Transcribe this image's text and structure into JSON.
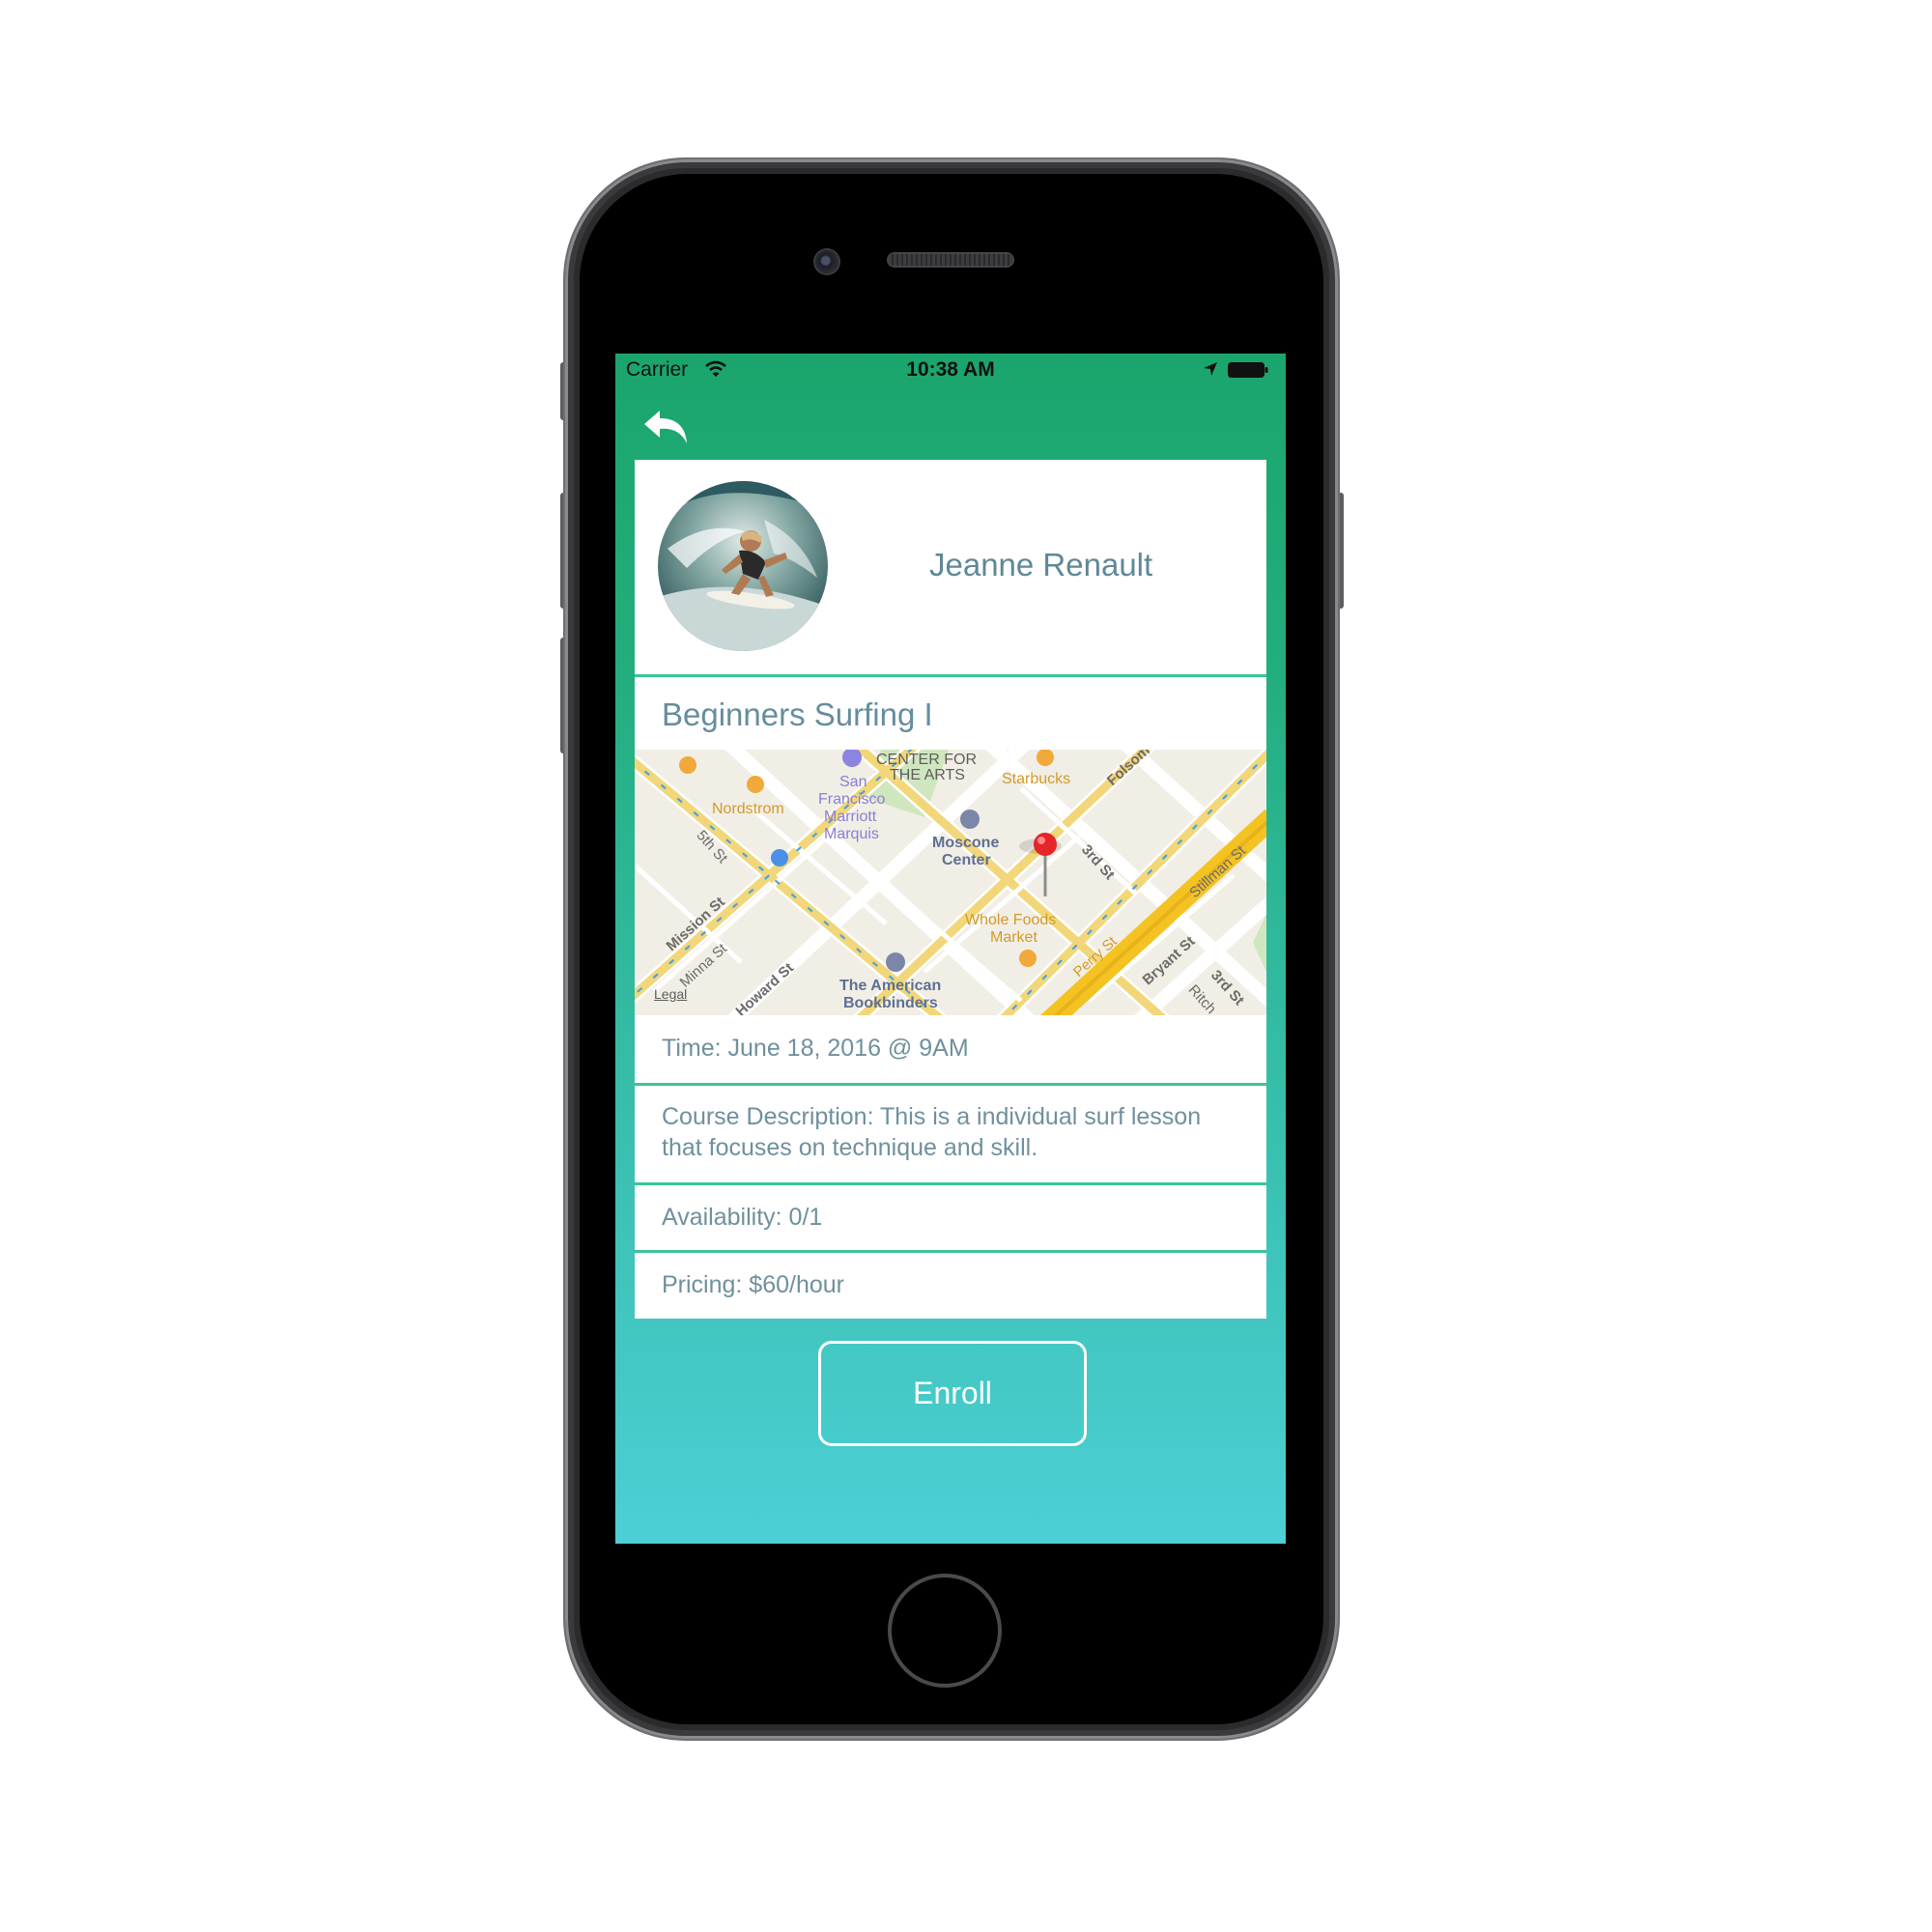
{
  "status_bar": {
    "carrier": "Carrier",
    "time": "10:38 AM",
    "icons": [
      "wifi-icon",
      "location-arrow-icon",
      "battery-icon"
    ]
  },
  "nav": {
    "back_icon": "reply-arrow-icon"
  },
  "instructor": {
    "name": "Jeanne Renault",
    "avatar": "surfer-photo"
  },
  "course": {
    "title": "Beginners Surfing I",
    "time": "Time: June 18, 2016 @ 9AM",
    "description": "Course Description: This is a individual surf lesson that focuses on technique and skill.",
    "availability": "Availability: 0/1",
    "pricing": "Pricing: $60/hour"
  },
  "map": {
    "labels": {
      "center_arts_1": "CENTER FOR",
      "center_arts_2": "THE ARTS",
      "starbucks": "Starbucks",
      "folsom": "Folsom",
      "nordstrom": "Nordstrom",
      "marriott_1": "San",
      "marriott_2": "Francisco",
      "marriott_3": "Marriott",
      "marriott_4": "Marquis",
      "moscone_1": "Moscone",
      "moscone_2": "Center",
      "third_st": "3rd St",
      "stillman": "Stillman St",
      "fifth_st": "5th St",
      "mission": "Mission St",
      "minna": "Minna St",
      "whole_foods_1": "Whole Foods",
      "whole_foods_2": "Market",
      "perry": "Perry St",
      "bryant": "Bryant St",
      "third_st_2": "3rd St",
      "ritch": "Ritch",
      "bookbinders_1": "The American",
      "bookbinders_2": "Bookbinders",
      "howard": "Howard St",
      "legal": "Legal"
    },
    "pin": "map-pin-icon"
  },
  "actions": {
    "enroll": "Enroll"
  },
  "colors": {
    "header_green": "#1ba56d",
    "gradient_bottom": "#4ccfd6",
    "divider": "#3cc39b",
    "text": "#6f909d"
  }
}
